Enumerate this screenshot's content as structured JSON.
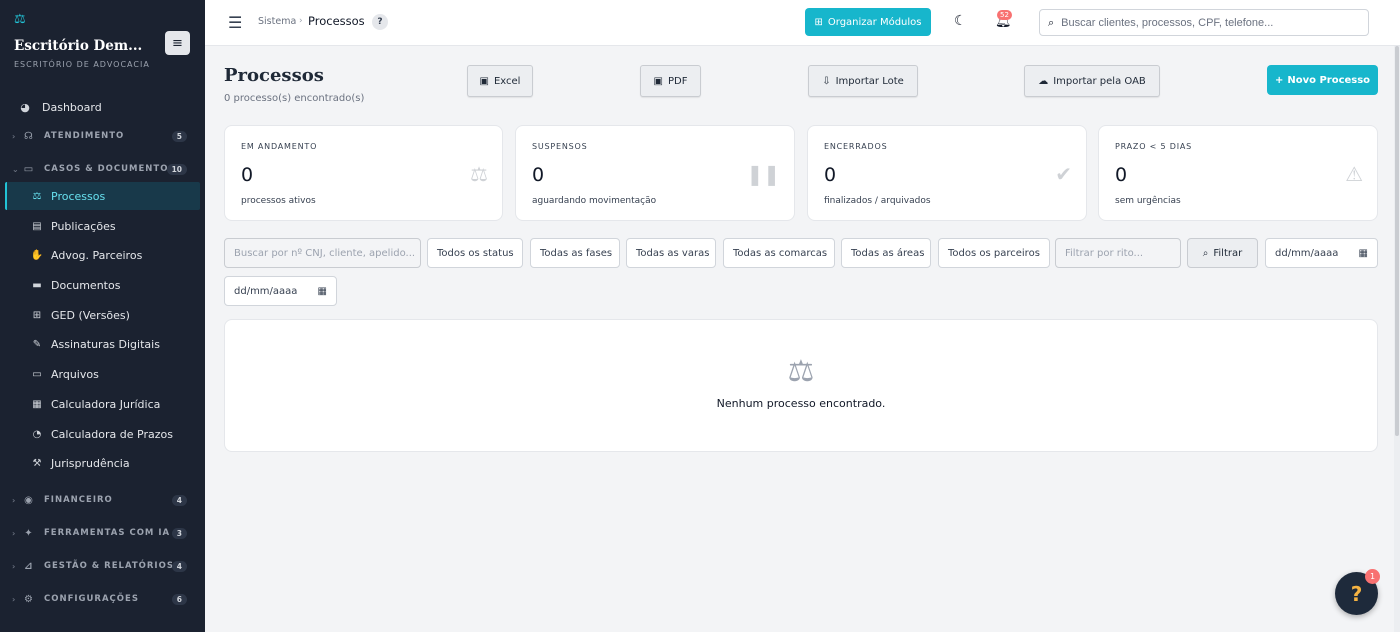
{
  "sidebar": {
    "brand_name": "Escritório Dem...",
    "brand_sub": "ESCRITÓRIO DE ADVOCACIA",
    "dashboard": "Dashboard",
    "groups": [
      {
        "label": "ATENDIMENTO",
        "count": "5"
      },
      {
        "label": "CASOS & DOCUMENTOS",
        "count": "10"
      },
      {
        "label": "FINANCEIRO",
        "count": "4"
      },
      {
        "label": "FERRAMENTAS COM IA",
        "count": "3"
      },
      {
        "label": "GESTÃO & RELATÓRIOS",
        "count": "4"
      },
      {
        "label": "CONFIGURAÇÕES",
        "count": "6"
      }
    ],
    "items": [
      {
        "label": "Processos"
      },
      {
        "label": "Publicações"
      },
      {
        "label": "Advog. Parceiros"
      },
      {
        "label": "Documentos"
      },
      {
        "label": "GED (Versões)"
      },
      {
        "label": "Assinaturas Digitais"
      },
      {
        "label": "Arquivos"
      },
      {
        "label": "Calculadora Jurídica"
      },
      {
        "label": "Calculadora de Prazos"
      },
      {
        "label": "Jurisprudência"
      }
    ]
  },
  "topbar": {
    "crumb_root": "Sistema",
    "crumb_sep": "›",
    "crumb_current": "Processos",
    "help": "?",
    "organize": "Organizar Módulos",
    "notif_count": "52",
    "search_placeholder": "Buscar clientes, processos, CPF, telefone..."
  },
  "main": {
    "title": "Processos",
    "subtitle": "0 processo(s) encontrado(s)",
    "buttons": {
      "excel": "Excel",
      "pdf": "PDF",
      "import_lot": "Importar Lote",
      "import_oab": "Importar pela OAB",
      "new": "Novo Processo"
    },
    "stats": [
      {
        "label": "EM ANDAMENTO",
        "value": "0",
        "desc": "processos ativos"
      },
      {
        "label": "SUSPENSOS",
        "value": "0",
        "desc": "aguardando movimentação"
      },
      {
        "label": "ENCERRADOS",
        "value": "0",
        "desc": "finalizados / arquivados"
      },
      {
        "label": "PRAZO < 5 DIAS",
        "value": "0",
        "desc": "sem urgências"
      }
    ],
    "filters": {
      "search_placeholder": "Buscar por nº CNJ, cliente, apelido...",
      "status": "Todos os status",
      "fases": "Todas as fases",
      "varas": "Todas as varas",
      "comarcas": "Todas as comarcas",
      "areas": "Todas as áreas",
      "parceiros": "Todos os parceiros",
      "rito_placeholder": "Filtrar por rito...",
      "filter_btn": "Filtrar",
      "date_from": "dd/mm/aaaa",
      "date_to": "dd/mm/aaaa"
    },
    "empty_text": "Nenhum processo encontrado."
  },
  "fab": {
    "label": "?",
    "badge": "1"
  },
  "colors": {
    "accent": "#17b6cc",
    "sidebar_bg": "#1b2230",
    "badge": "#f87171"
  }
}
